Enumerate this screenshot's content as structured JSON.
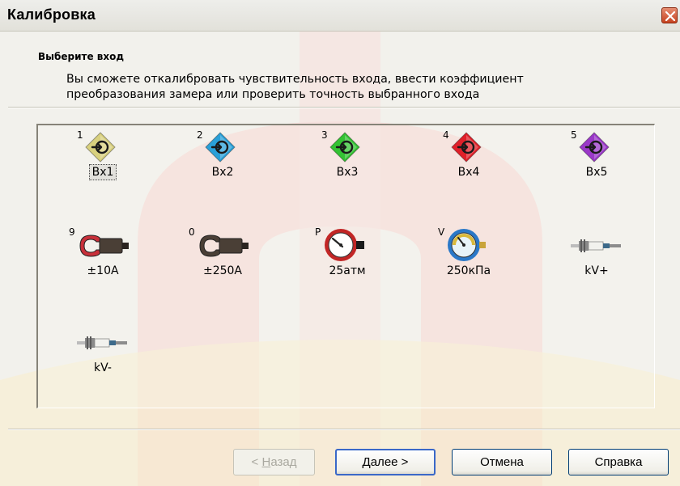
{
  "window": {
    "title": "Калибровка"
  },
  "header": {
    "step_title": "Выберите вход",
    "description_line1": "Вы сможете откалибровать чувствительность входа, ввести коэффициент",
    "description_line2": "преобразования замера или проверить точность выбранного входа"
  },
  "inputs": [
    {
      "number": "1",
      "label": "Вх1",
      "icon": "input-connector-icon",
      "color": "#d8d07e",
      "selected": true
    },
    {
      "number": "2",
      "label": "Вх2",
      "icon": "input-connector-icon",
      "color": "#2aa0d8"
    },
    {
      "number": "3",
      "label": "Вх3",
      "icon": "input-connector-icon",
      "color": "#33c233"
    },
    {
      "number": "4",
      "label": "Вх4",
      "icon": "input-connector-icon",
      "color": "#e0202a"
    },
    {
      "number": "5",
      "label": "Вх5",
      "icon": "input-connector-icon",
      "color": "#9a38c8"
    },
    {
      "number": "9",
      "label": "±10А",
      "icon": "current-clamp-icon",
      "color": "#c8303a"
    },
    {
      "number": "0",
      "label": "±250А",
      "icon": "current-clamp-icon",
      "color": "#4a3f36"
    },
    {
      "number": "P",
      "label": "25атм",
      "icon": "pressure-gauge-icon",
      "color": "#c22626"
    },
    {
      "number": "V",
      "label": "250кПа",
      "icon": "vacuum-gauge-icon",
      "color": "#2a78c8"
    },
    {
      "number": "",
      "label": "kV+",
      "icon": "spark-plug-icon",
      "color": "#6c6c6c"
    },
    {
      "number": "",
      "label": "kV-",
      "icon": "spark-plug-icon",
      "color": "#6c6c6c"
    }
  ],
  "buttons": {
    "back": {
      "accel": "Н",
      "rest": "азад",
      "prefix": "< "
    },
    "next": {
      "accel": "Д",
      "rest": "алее >"
    },
    "cancel": "Отмена",
    "help": "Справка"
  }
}
